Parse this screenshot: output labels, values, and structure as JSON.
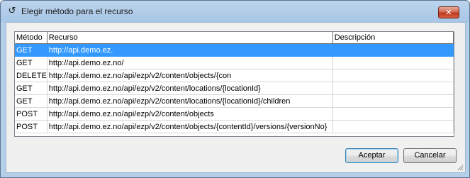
{
  "window": {
    "title": "Elegir método para el recurso",
    "close_label": "✕"
  },
  "table": {
    "columns": [
      "Método",
      "Recurso",
      "Descripción"
    ],
    "rows": [
      {
        "method": "GET",
        "resource": "http://api.demo.ez.",
        "description": "",
        "selected": true
      },
      {
        "method": "GET",
        "resource": "http://api.demo.ez.no/",
        "description": ""
      },
      {
        "method": "DELETE",
        "resource": "http://api.demo.ez.no/api/ezp/v2/content/objects/{con",
        "description": ""
      },
      {
        "method": "GET",
        "resource": "http://api.demo.ez.no/api/ezp/v2/content/locations/{locationId}",
        "description": ""
      },
      {
        "method": "GET",
        "resource": "http://api.demo.ez.no/api/ezp/v2/content/locations/{locationId}/children",
        "description": ""
      },
      {
        "method": "POST",
        "resource": "http://api.demo.ez.no/api/ezp/v2/content/objects",
        "description": ""
      },
      {
        "method": "POST",
        "resource": "http://api.demo.ez.no/api/ezp/v2/content/objects/{contentId}/versions/{versionNo}",
        "description": ""
      }
    ]
  },
  "buttons": {
    "accept": "Aceptar",
    "cancel": "Cancelar"
  },
  "colors": {
    "selection": "#3399ff",
    "title_gradient": "#bcd4ec"
  }
}
